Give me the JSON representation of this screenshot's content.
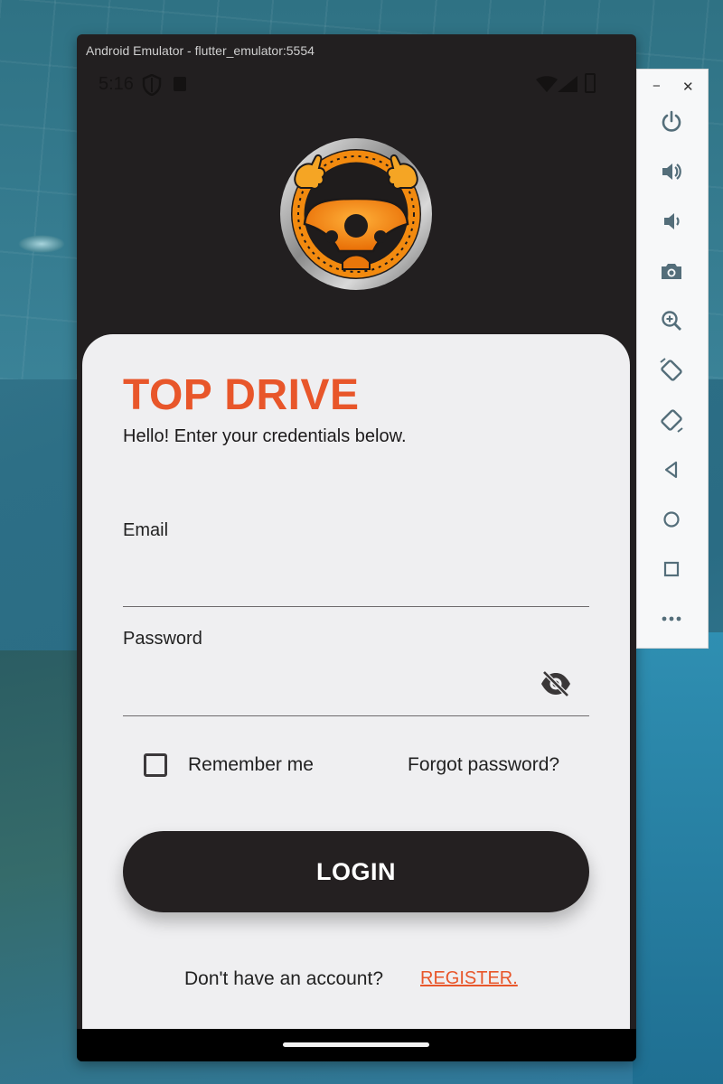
{
  "window": {
    "title": "Android Emulator - flutter_emulator:5554"
  },
  "status_bar": {
    "time": "5:16"
  },
  "app": {
    "brand_title": "TOP DRIVE",
    "subtitle": "Hello! Enter your credentials below.",
    "email": {
      "label": "Email",
      "value": "",
      "placeholder": ""
    },
    "password": {
      "label": "Password",
      "value": "",
      "placeholder": "",
      "visibility_icon": "visibility-off-icon"
    },
    "remember_me": {
      "label": "Remember me",
      "checked": false
    },
    "forgot_password": "Forgot password?",
    "login_button": "LOGIN",
    "no_account_text": "Don't have an account?",
    "register_link": "REGISTER."
  },
  "toolbar": {
    "minimize": "−",
    "close": "✕",
    "buttons": [
      "power-icon",
      "volume-up-icon",
      "volume-down-icon",
      "camera-icon",
      "zoom-in-icon",
      "rotate-left-icon",
      "rotate-right-icon",
      "back-icon",
      "home-icon",
      "overview-icon",
      "more-icon"
    ]
  },
  "colors": {
    "accent": "#e8562a",
    "app_dark": "#242021",
    "card_background": "#efeff1",
    "logo_orange": "#f28a0f"
  }
}
